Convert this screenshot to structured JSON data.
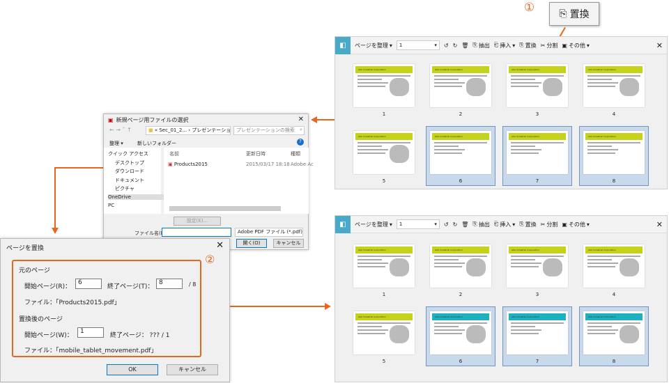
{
  "callout": {
    "step1": "①",
    "step2": "②",
    "replace_label": "置換"
  },
  "toolbar": {
    "organize": "ページを整理",
    "page_select": "1",
    "extract": "抽出",
    "insert": "挿入",
    "replace": "置換",
    "split": "分割",
    "other": "その他"
  },
  "thumb_brand": "ASA Industrial Corporation",
  "top_pages": [
    {
      "n": "1",
      "band": "#c5d21a",
      "sel": false,
      "img": true
    },
    {
      "n": "2",
      "band": "#c5d21a",
      "sel": false,
      "img": true
    },
    {
      "n": "3",
      "band": "#c5d21a",
      "sel": false,
      "img": true
    },
    {
      "n": "4",
      "band": "#c5d21a",
      "sel": false,
      "img": true
    },
    {
      "n": "5",
      "band": "#c5d21a",
      "sel": false,
      "img": true
    },
    {
      "n": "6",
      "band": "#c5d21a",
      "sel": true,
      "img": false
    },
    {
      "n": "7",
      "band": "#c5d21a",
      "sel": true,
      "img": false
    },
    {
      "n": "8",
      "band": "#c5d21a",
      "sel": true,
      "img": false
    }
  ],
  "bottom_pages": [
    {
      "n": "1",
      "band": "#c5d21a",
      "sel": false,
      "img": true
    },
    {
      "n": "2",
      "band": "#c5d21a",
      "sel": false,
      "img": true
    },
    {
      "n": "3",
      "band": "#c5d21a",
      "sel": false,
      "img": true
    },
    {
      "n": "4",
      "band": "#c5d21a",
      "sel": false,
      "img": true
    },
    {
      "n": "5",
      "band": "#c5d21a",
      "sel": false,
      "img": true
    },
    {
      "n": "6",
      "band": "#1fb0c0",
      "sel": true,
      "img": true
    },
    {
      "n": "7",
      "band": "#1fb0c0",
      "sel": true,
      "img": false
    },
    {
      "n": "8",
      "band": "#1fb0c0",
      "sel": true,
      "img": true
    }
  ],
  "file_dialog": {
    "title": "新規ページ用ファイルの選択",
    "path1": "« Sec_01_2...",
    "path2": "プレゼンテーション",
    "search_placeholder": "プレゼンテーションの検索",
    "organize": "整理 ▾",
    "new_folder": "新しいフォルダー",
    "nav": [
      "クイック アクセス",
      "デスクトップ",
      "ダウンロード",
      "ドキュメント",
      "ピクチャ",
      "OneDrive",
      "PC"
    ],
    "col_name": "名前",
    "col_date": "更新日時",
    "col_type": "種類",
    "file_name": "Products2015",
    "file_date": "2015/03/17 18:18",
    "file_type": "Adobe Ac",
    "settings": "設定(E)...",
    "filename_label": "ファイル名(N):",
    "filetype": "Adobe PDF ファイル (*.pdf)",
    "open": "開く(O)",
    "cancel": "キャンセル"
  },
  "replace_dialog": {
    "title": "ページを置換",
    "orig_group": "元のページ",
    "start_label": "開始ページ(R)：",
    "start_value": "6",
    "end_label": "終了ページ(T)：",
    "end_value": "8",
    "total": "/ 8",
    "orig_file": "ファイル：「Products2015.pdf」",
    "new_group": "置換後のページ",
    "new_start_label": "開始ページ(W)：",
    "new_start_value": "1",
    "new_end": "終了ページ： ??? / 1",
    "new_file": "ファイル：「mobile_tablet_movement.pdf」",
    "ok": "OK",
    "cancel": "キャンセル"
  },
  "colors": {
    "accent": "#e8671c",
    "selected": "#c9d9ec"
  }
}
